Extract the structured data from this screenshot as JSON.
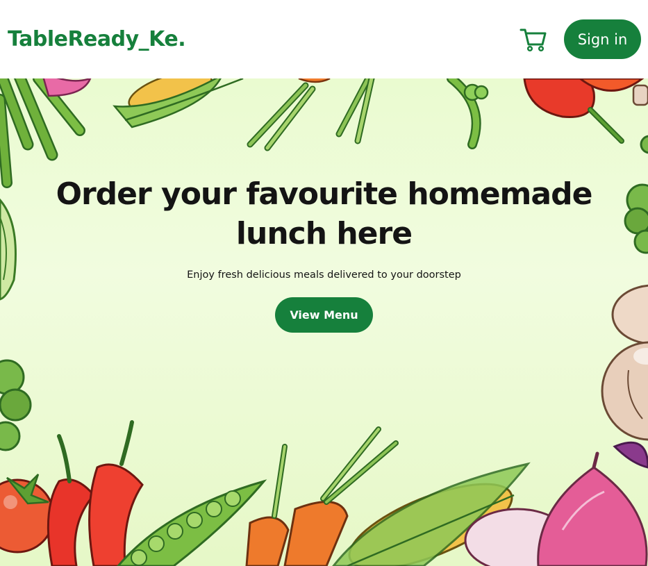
{
  "header": {
    "logo": "TableReady_Ke.",
    "cart_icon": "shopping-cart-icon",
    "signin_label": "Sign in"
  },
  "hero": {
    "title": "Order your favourite homemade lunch here",
    "subtitle": "Enjoy fresh delicious meals delivered to your doorstep",
    "cta_label": "View Menu"
  },
  "colors": {
    "brand_green": "#16803c",
    "hero_background": "#eafbd0",
    "text_dark": "#141414"
  },
  "decorations": [
    "green-beans-illustration",
    "corn-illustration",
    "spring-onion-illustration",
    "pea-pod-illustration",
    "tomato-illustration",
    "broccoli-illustration",
    "chili-pepper-illustration",
    "carrot-illustration",
    "onion-illustration",
    "mushroom-illustration"
  ]
}
